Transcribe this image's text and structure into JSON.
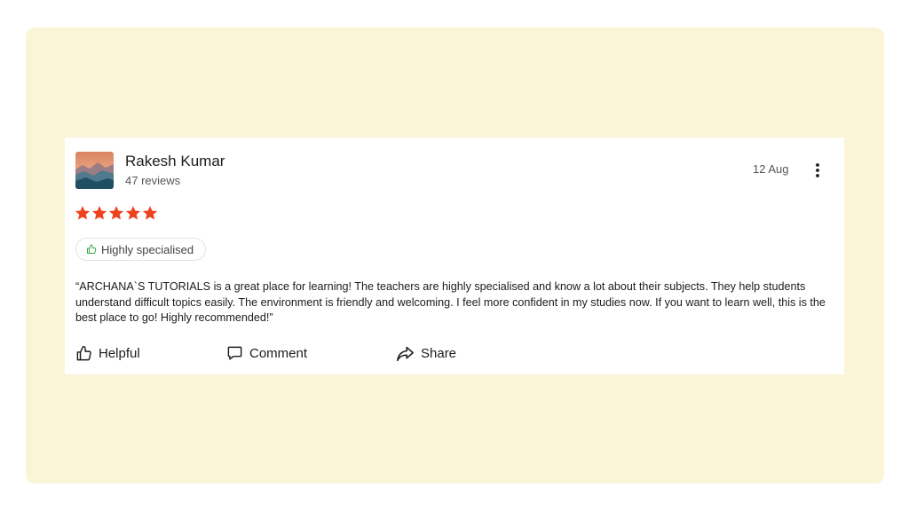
{
  "review": {
    "author_name": "Rakesh Kumar",
    "review_count": "47 reviews",
    "date": "12 Aug",
    "rating": 5,
    "rating_max": 5,
    "tag_label": "Highly specialised",
    "text": "“ARCHANA`S TUTORIALS is a great place for learning! The teachers are highly specialised and know a lot about their subjects. They help students understand difficult topics easily. The environment is friendly and welcoming. I feel more confident in my studies now. If you want to learn well, this is the best place to go! Highly recommended!”"
  },
  "actions": {
    "helpful_label": "Helpful",
    "comment_label": "Comment",
    "share_label": "Share"
  },
  "icons": {
    "menu": "more-vertical-icon",
    "tag": "thumbs-up-icon",
    "helpful": "thumbs-up-icon",
    "comment": "comment-bubble-icon",
    "share": "share-arrow-icon"
  },
  "colors": {
    "frame_background": "#fbf5d8",
    "card_background": "#ffffff",
    "star": "#f0411d",
    "tag_icon": "#3aa845",
    "text_primary": "#1b1b1b",
    "text_secondary": "#555555"
  }
}
